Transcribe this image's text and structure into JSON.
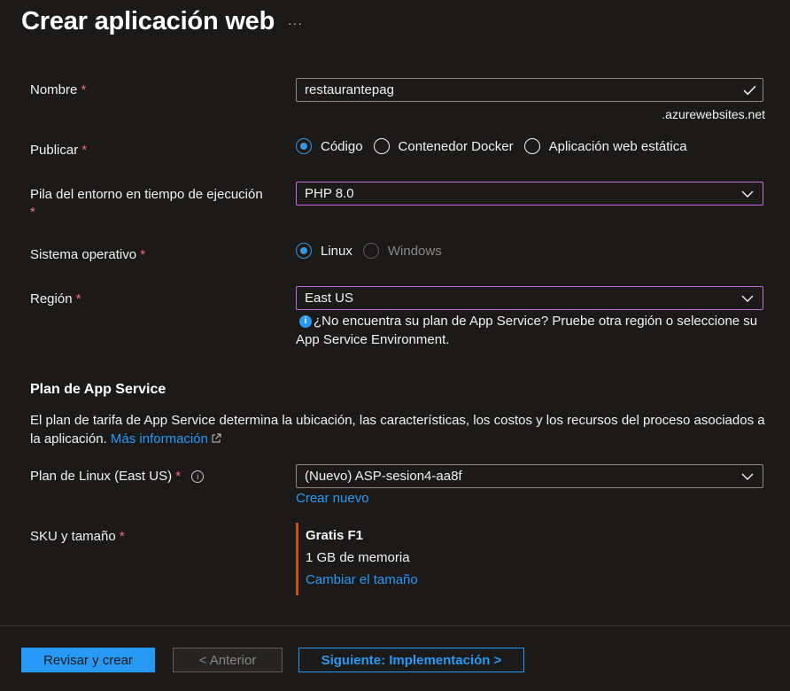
{
  "header": {
    "title": "Crear aplicación web",
    "more": "···"
  },
  "required_mark": "*",
  "nombre": {
    "label": "Nombre",
    "value": "restaurantepag",
    "suffix": ".azurewebsites.net"
  },
  "publicar": {
    "label": "Publicar",
    "options": [
      "Código",
      "Contenedor Docker",
      "Aplicación web estática"
    ],
    "selected": "Código"
  },
  "pila": {
    "label": "Pila del entorno en tiempo de ejecución",
    "value": "PHP 8.0"
  },
  "so": {
    "label": "Sistema operativo",
    "options": [
      "Linux",
      "Windows"
    ],
    "selected": "Linux",
    "disabled": "Windows"
  },
  "region": {
    "label": "Región",
    "value": "East US",
    "note": "¿No encuentra su plan de App Service? Pruebe otra región o seleccione su App Service Environment."
  },
  "plan_section": {
    "heading": "Plan de App Service",
    "description": "El plan de tarifa de App Service determina la ubicación, las características, los costos y los recursos del proceso asociados a la aplicación.",
    "more_link": "Más información"
  },
  "plan_linux": {
    "label": "Plan de Linux (East US)",
    "value": "(Nuevo) ASP-sesion4-aa8f",
    "create_link": "Crear nuevo"
  },
  "sku": {
    "label": "SKU y tamaño",
    "tier": "Gratis F1",
    "memory": "1 GB de memoria",
    "change_link": "Cambiar el tamaño"
  },
  "footer": {
    "review": "Revisar y crear",
    "previous": "< Anterior",
    "next": "Siguiente: Implementación >"
  },
  "colors": {
    "accent": "#2899f5",
    "focus_border": "#c76cdf",
    "required": "#f1707b",
    "sku_bar": "#ca5010",
    "background": "#1b1a19"
  },
  "icons": [
    "more-icon",
    "check-icon",
    "chevron-down-icon",
    "info-icon",
    "external-link-icon"
  ]
}
